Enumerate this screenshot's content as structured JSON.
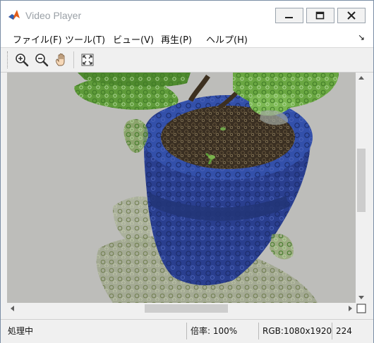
{
  "window": {
    "title": "Video Player"
  },
  "menu": {
    "items": [
      {
        "label": "ファイル(F)"
      },
      {
        "label": "ツール(T)"
      },
      {
        "label": "ビュー(V)"
      },
      {
        "label": "再生(P)"
      },
      {
        "label": "ヘルプ(H)"
      }
    ],
    "overflow_glyph": "↘"
  },
  "toolbar": {
    "buttons": [
      {
        "icon": "zoom-in-icon"
      },
      {
        "icon": "zoom-out-icon"
      },
      {
        "icon": "pan-hand-icon"
      },
      {
        "icon": "fit-to-window-icon"
      }
    ]
  },
  "scrollbars": {
    "horizontal_position": 0.52,
    "vertical_position": 0.45
  },
  "status": {
    "state": "処理中",
    "zoom": "倍率: 100%",
    "format": "RGB:1080x1920",
    "frame": "224"
  },
  "colors": {
    "title_inactive": "#9aa0a6",
    "pot_blue": "#2a3f8f",
    "leaf_green": "#5f9b3a",
    "background_gray": "#b8b8b6"
  }
}
